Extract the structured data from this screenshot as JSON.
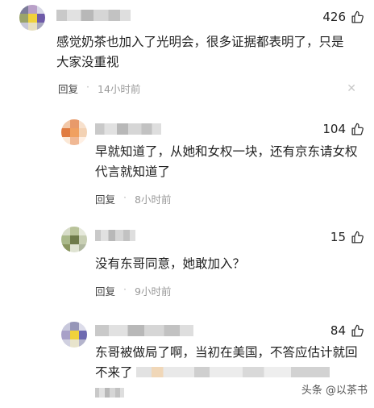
{
  "comments": [
    {
      "likes": "426",
      "text": "感觉奶茶也加入了光明会，很多证据都表明了，只是大家没重视",
      "reply_label": "回复",
      "separator": "·",
      "time": "14小时前",
      "close": "✕"
    },
    {
      "likes": "104",
      "text": "早就知道了，从她和女权一块，还有京东请女权代言就知道了",
      "reply_label": "回复",
      "separator": "·",
      "time": "8小时前"
    },
    {
      "likes": "15",
      "text": "没有东哥同意，她敢加入？",
      "reply_label": "回复",
      "separator": "·",
      "time": "9小时前"
    },
    {
      "likes": "84",
      "text_line1": "东哥被做局了啊，当初在美国，不答应估计就回",
      "text_line2_start": "不来了"
    }
  ],
  "watermark": "头条 @以茶书",
  "colors": {
    "text": "#222222",
    "meta": "#9a9a9a",
    "icon": "#333333"
  }
}
